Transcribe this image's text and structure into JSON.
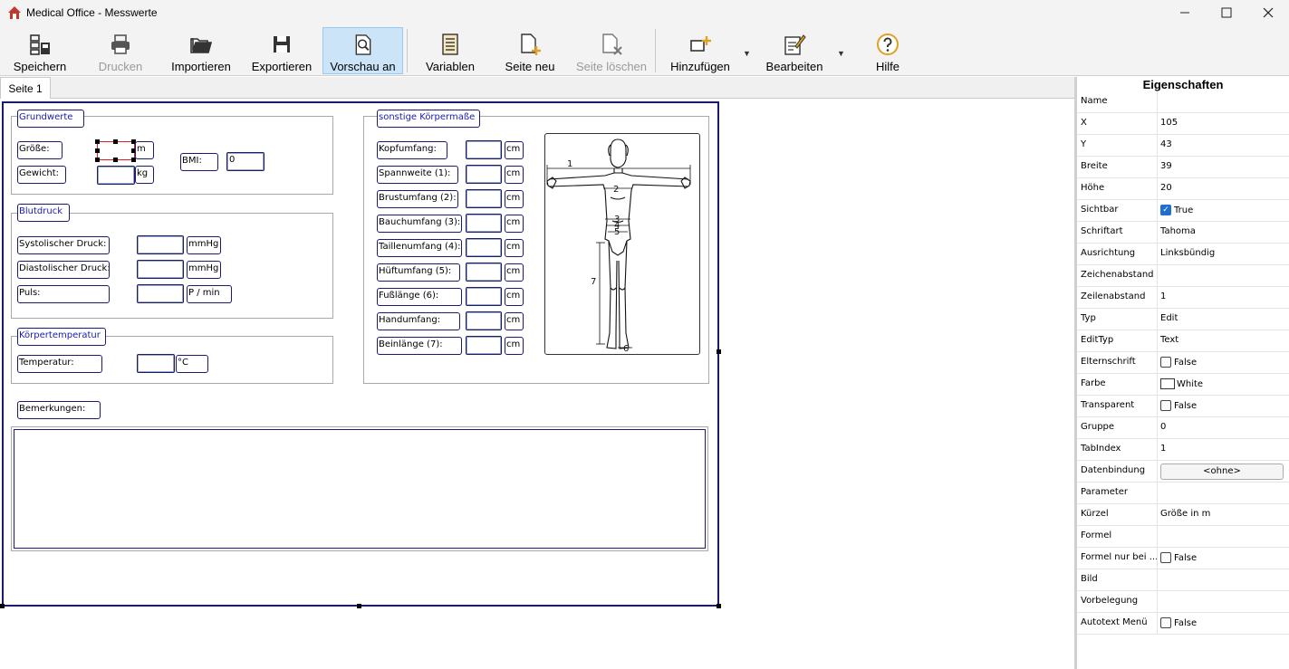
{
  "window": {
    "title": "Medical Office - Messwerte",
    "min_label": "—",
    "max_label": "☐",
    "close_label": "✕"
  },
  "toolbar": {
    "save": "Speichern",
    "print": "Drucken",
    "import": "Importieren",
    "export": "Exportieren",
    "preview": "Vorschau an",
    "variables": "Variablen",
    "new_page": "Seite neu",
    "delete_page": "Seite löschen",
    "add": "Hinzufügen",
    "edit": "Bearbeiten",
    "help": "Hilfe",
    "dropdown_arrow": "▼"
  },
  "tabs": {
    "page1": "Seite 1"
  },
  "form": {
    "grundwerte": {
      "title": "Grundwerte",
      "groesse_label": "Größe:",
      "groesse_unit": "m",
      "gewicht_label": "Gewicht:",
      "gewicht_unit": "kg",
      "bmi_label": "BMI:",
      "bmi_value": "0"
    },
    "blutdruck": {
      "title": "Blutdruck",
      "systolisch_label": "Systolischer Druck:",
      "systolisch_unit": "mmHg",
      "diastolisch_label": "Diastolischer Druck:",
      "diastolisch_unit": "mmHg",
      "puls_label": "Puls:",
      "puls_unit": "P / min"
    },
    "temperatur": {
      "title": "Körpertemperatur",
      "label": "Temperatur:",
      "unit": "°C"
    },
    "koerpermasse": {
      "title": "sonstige Körpermaße",
      "rows": [
        {
          "label": "Kopfumfang:",
          "unit": "cm"
        },
        {
          "label": "Spannweite (1):",
          "unit": "cm"
        },
        {
          "label": "Brustumfang (2):",
          "unit": "cm"
        },
        {
          "label": "Bauchumfang (3):",
          "unit": "cm"
        },
        {
          "label": "Taillenumfang (4):",
          "unit": "cm"
        },
        {
          "label": "Hüftumfang (5):",
          "unit": "cm"
        },
        {
          "label": "Fußlänge (6):",
          "unit": "cm"
        },
        {
          "label": "Handumfang:",
          "unit": "cm"
        },
        {
          "label": "Beinlänge (7):",
          "unit": "cm"
        }
      ],
      "figure_marks": [
        "1",
        "2",
        "3",
        "4",
        "5",
        "6",
        "7"
      ]
    },
    "bemerkungen_label": "Bemerkungen:"
  },
  "properties": {
    "title": "Eigenschaften",
    "rows": [
      {
        "name": "Name",
        "value": ""
      },
      {
        "name": "X",
        "value": "105"
      },
      {
        "name": "Y",
        "value": "43"
      },
      {
        "name": "Breite",
        "value": "39"
      },
      {
        "name": "Höhe",
        "value": "20"
      },
      {
        "name": "Sichtbar",
        "value": "True"
      },
      {
        "name": "Schriftart",
        "value": "Tahoma"
      },
      {
        "name": "Ausrichtung",
        "value": "Linksbündig"
      },
      {
        "name": "Zeichenabstand",
        "value": ""
      },
      {
        "name": "Zeilenabstand",
        "value": "1"
      },
      {
        "name": "Typ",
        "value": "Edit"
      },
      {
        "name": "EditTyp",
        "value": "Text"
      },
      {
        "name": "Elternschrift",
        "value": "False"
      },
      {
        "name": "Farbe",
        "value": "White"
      },
      {
        "name": "Transparent",
        "value": "False"
      },
      {
        "name": "Gruppe",
        "value": "0"
      },
      {
        "name": "TabIndex",
        "value": "1"
      },
      {
        "name": "Datenbindung",
        "value": "<ohne>"
      },
      {
        "name": "Parameter",
        "value": ""
      },
      {
        "name": "Kürzel",
        "value": "Größe in m"
      },
      {
        "name": "Formel",
        "value": ""
      },
      {
        "name": "Formel nur bei ...",
        "value": "False"
      },
      {
        "name": "Bild",
        "value": ""
      },
      {
        "name": "Vorbelegung",
        "value": ""
      },
      {
        "name": "Autotext Menü",
        "value": "False"
      }
    ]
  },
  "colors": {
    "accent": "#1a1a6e",
    "label_blue": "#1a1ab4",
    "preview_active": "#cce4f7",
    "checkbox_on": "#1f6fd0"
  }
}
